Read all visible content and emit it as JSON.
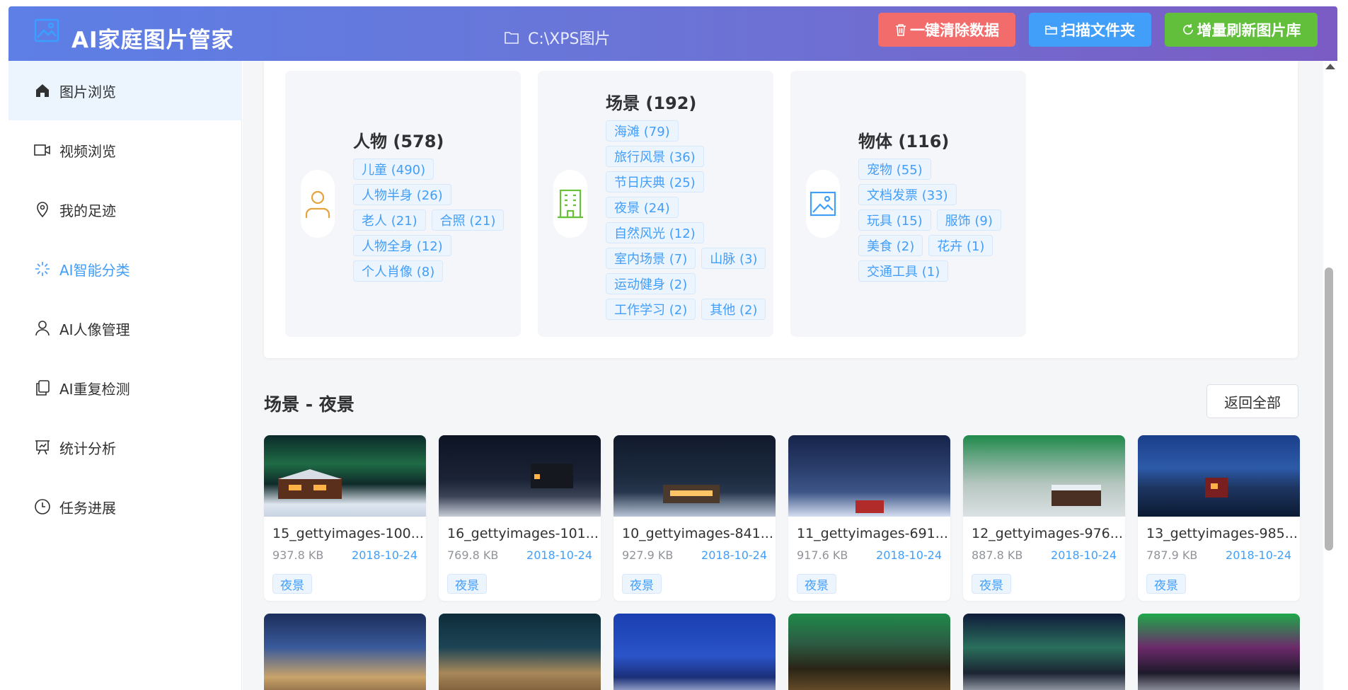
{
  "header": {
    "title": "AI家庭图片管家",
    "path": "C:\\XPS图片",
    "btn_clear": "一键清除数据",
    "btn_scan": "扫描文件夹",
    "btn_refresh": "增量刷新图片库"
  },
  "sidebar": {
    "items": [
      {
        "label": "图片浏览",
        "icon": "home-icon"
      },
      {
        "label": "视频浏览",
        "icon": "video-icon"
      },
      {
        "label": "我的足迹",
        "icon": "location-pin-icon"
      },
      {
        "label": "AI智能分类",
        "icon": "loading-sparkle-icon"
      },
      {
        "label": "AI人像管理",
        "icon": "user-icon"
      },
      {
        "label": "AI重复检测",
        "icon": "copy-icon"
      },
      {
        "label": "统计分析",
        "icon": "presentation-chart-icon"
      },
      {
        "label": "任务进展",
        "icon": "clock-icon"
      }
    ]
  },
  "categories": [
    {
      "title": "人物 (578)",
      "icon": "user-icon",
      "color": "#e6a23c",
      "tags": [
        "儿童 (490)",
        "人物半身 (26)",
        "老人 (21)",
        "合照 (21)",
        "人物全身 (12)",
        "个人肖像 (8)"
      ]
    },
    {
      "title": "场景 (192)",
      "icon": "building-icon",
      "color": "#67c23a",
      "tags": [
        "海滩 (79)",
        "旅行风景 (36)",
        "节日庆典 (25)",
        "夜景 (24)",
        "自然风光 (12)",
        "室内场景 (7)",
        "山脉 (3)",
        "运动健身 (2)",
        "工作学习 (2)",
        "其他 (2)"
      ]
    },
    {
      "title": "物体 (116)",
      "icon": "picture-icon",
      "color": "#419ef9",
      "tags": [
        "宠物 (55)",
        "文档发票 (33)",
        "玩具 (15)",
        "服饰 (9)",
        "美食 (2)",
        "花卉 (1)",
        "交通工具 (1)"
      ]
    }
  ],
  "section": {
    "title": "场景 - 夜景",
    "back_label": "返回全部"
  },
  "photos": [
    {
      "name": "15_gettyimages-100...",
      "size": "937.8 KB",
      "date": "2018-10-24",
      "tag": "夜景"
    },
    {
      "name": "16_gettyimages-101...",
      "size": "769.8 KB",
      "date": "2018-10-24",
      "tag": "夜景"
    },
    {
      "name": "10_gettyimages-841...",
      "size": "927.9 KB",
      "date": "2018-10-24",
      "tag": "夜景"
    },
    {
      "name": "11_gettyimages-691...",
      "size": "917.6 KB",
      "date": "2018-10-24",
      "tag": "夜景"
    },
    {
      "name": "12_gettyimages-976...",
      "size": "887.8 KB",
      "date": "2018-10-24",
      "tag": "夜景"
    },
    {
      "name": "13_gettyimages-985...",
      "size": "787.9 KB",
      "date": "2018-10-24",
      "tag": "夜景"
    }
  ],
  "colors": {
    "accent": "#419ef9",
    "danger": "#f36c6c",
    "success": "#61bf3c",
    "header_start": "#5d7fe6",
    "header_end": "#7b5cc4"
  }
}
